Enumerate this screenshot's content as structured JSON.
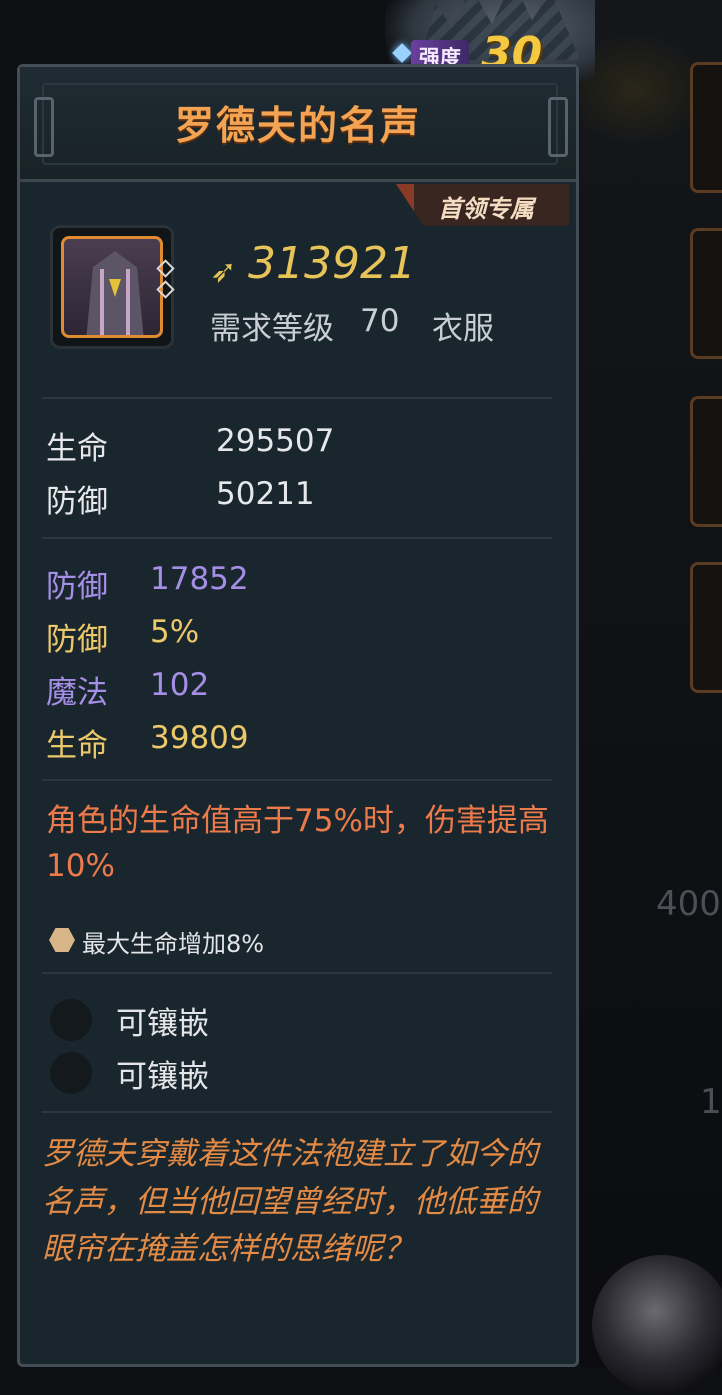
{
  "item": {
    "strength_label": "强度",
    "strength_value": "30",
    "name": "罗德夫的名声",
    "exclusive_tag": "首领专属",
    "price_icon": "currency-icon",
    "price": "313921",
    "level_req_label": "需求等级",
    "level_req_value": "70",
    "slot_type": "衣服"
  },
  "base_stats": [
    {
      "label": "生命",
      "value": "295507"
    },
    {
      "label": "防御",
      "value": "50211"
    }
  ],
  "extra_stats": [
    {
      "label": "防御",
      "value": "17852",
      "color": "#a58ee6"
    },
    {
      "label": "防御",
      "value": "5%",
      "color": "#ebc86a"
    },
    {
      "label": "魔法",
      "value": "102",
      "color": "#a58ee6"
    },
    {
      "label": "生命",
      "value": "39809",
      "color": "#ebc86a"
    }
  ],
  "passive": "角色的生命值高于75%时，伤害提高10%",
  "set_bonus": "最大生命增加8%",
  "sockets": [
    {
      "label": "可镶嵌"
    },
    {
      "label": "可镶嵌"
    }
  ],
  "lore": "罗德夫穿戴着这件法袍建立了如今的名声，但当他回望曾经时，他低垂的眼帘在掩盖怎样的思绪呢？",
  "background": {
    "side_number_1": "400",
    "side_number_2": "1"
  },
  "colors": {
    "title": "#f3a352",
    "price": "#e7c45a",
    "purple_stat": "#a58ee6",
    "gold_stat": "#ebc86a",
    "passive": "#ec7a4a",
    "lore": "#e38a45"
  }
}
